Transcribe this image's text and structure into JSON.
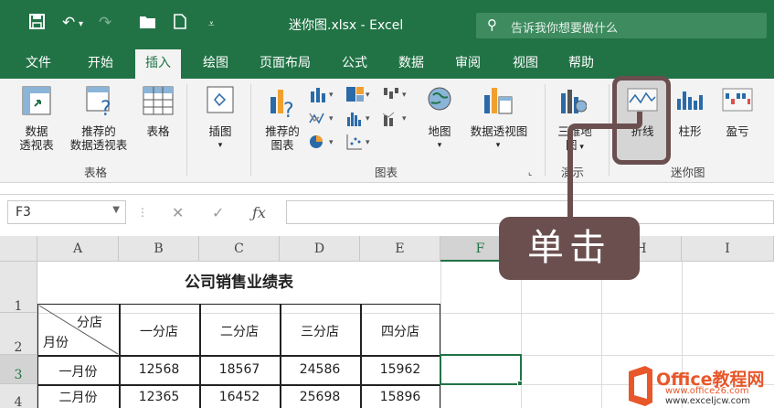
{
  "title": "迷你图.xlsx  -  Excel",
  "search_placeholder": "告诉我你想要做什么",
  "tabs": [
    "文件",
    "开始",
    "插入",
    "绘图",
    "页面布局",
    "公式",
    "数据",
    "审阅",
    "视图",
    "帮助"
  ],
  "active_tab": "插入",
  "ribbon": {
    "pivot_table_1": "数据",
    "pivot_table_2": "透视表",
    "recommended_pivot_1": "推荐的",
    "recommended_pivot_2": "数据透视表",
    "table": "表格",
    "group_tables": "表格",
    "illustrations": "插图",
    "recommended_charts_1": "推荐的",
    "recommended_charts_2": "图表",
    "maps": "地图",
    "pivot_chart": "数据透视图",
    "group_charts": "图表",
    "map_3d_1": "三维地",
    "map_3d_2": "图",
    "group_tours": "演示",
    "sparkline_line": "折线",
    "sparkline_column": "柱形",
    "sparkline_winloss": "盈亏",
    "group_sparklines": "迷你图"
  },
  "name_box": "F3",
  "columns": [
    "A",
    "B",
    "C",
    "D",
    "E",
    "F",
    "G",
    "H",
    "I"
  ],
  "rows": [
    "1",
    "2",
    "3",
    "4"
  ],
  "sheet": {
    "table_title": "公司销售业绩表",
    "header_diag_top": "分店",
    "header_diag_bottom": "月份",
    "headers": [
      "一分店",
      "二分店",
      "三分店",
      "四分店"
    ],
    "row3": [
      "一月份",
      "12568",
      "18567",
      "24586",
      "15962"
    ],
    "row4": [
      "二月份",
      "12365",
      "16452",
      "25698",
      "15896"
    ]
  },
  "callout": "单击",
  "watermark": {
    "brand": "Office教程网",
    "url1": "www.office26.com",
    "url2": "www.exceljcw.com"
  },
  "colors": {
    "excel_green": "#217346",
    "callout": "#6b4f4f"
  }
}
